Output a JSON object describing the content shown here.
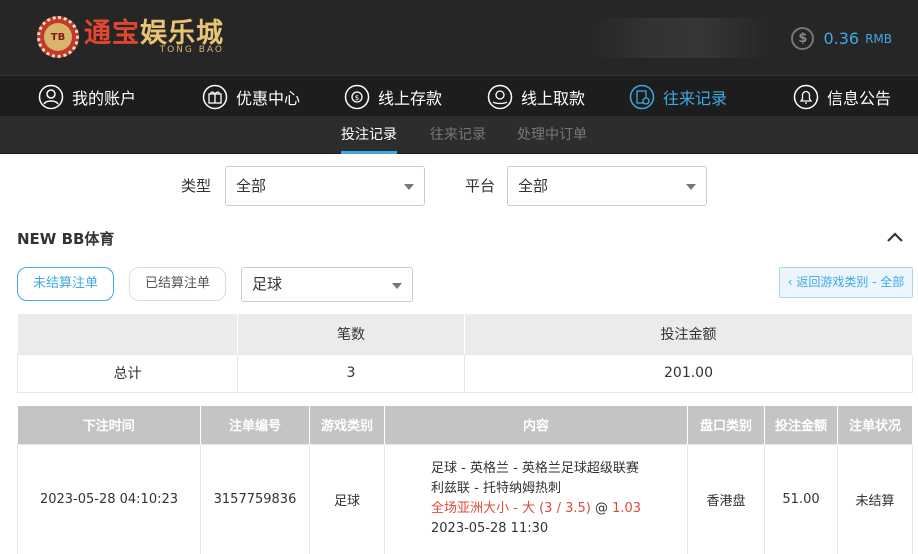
{
  "header": {
    "logo": {
      "cn_part1": "通宝",
      "cn_part2": "娱乐城",
      "en": "TONG BAO",
      "badge": "TB"
    },
    "balance": {
      "amount": "0.36",
      "currency": "RMB",
      "icon": "dollar-icon"
    }
  },
  "nav": {
    "items": [
      {
        "label": "我的账户",
        "icon": "user-icon"
      },
      {
        "label": "优惠中心",
        "icon": "gift-icon"
      },
      {
        "label": "线上存款",
        "icon": "deposit-icon"
      },
      {
        "label": "线上取款",
        "icon": "withdraw-icon"
      },
      {
        "label": "往来记录",
        "icon": "records-icon"
      },
      {
        "label": "信息公告",
        "icon": "bell-icon"
      }
    ],
    "active_index": 4
  },
  "subnav": {
    "items": [
      "投注记录",
      "往来记录",
      "处理中订单"
    ],
    "active_index": 0
  },
  "filters": {
    "type_label": "类型",
    "type_value": "全部",
    "platform_label": "平台",
    "platform_value": "全部"
  },
  "section": {
    "title": "NEW BB体育",
    "tab_unsettled": "未结算注单",
    "tab_settled": "已结算注单",
    "sport_value": "足球",
    "back_label": "‹ 返回游戏类别 - 全部"
  },
  "summary": {
    "headers": [
      "",
      "笔数",
      "投注金额"
    ],
    "row": {
      "label": "总计",
      "count": "3",
      "amount": "201.00"
    }
  },
  "bets": {
    "headers": [
      "下注时间",
      "注单编号",
      "游戏类别",
      "内容",
      "盘口类别",
      "投注金额",
      "注单状况"
    ],
    "rows": [
      {
        "time": "2023-05-28 04:10:23",
        "id": "3157759836",
        "game": "足球",
        "content_line1": "足球 - 英格兰 - 英格兰足球超级联赛",
        "content_line2": "利兹联 - 托特纳姆热刺",
        "content_bet": "全场亚洲大小 - 大 (3 / 3.5)",
        "content_at": " @ ",
        "content_odds": "1.03",
        "content_time": "2023-05-28 11:30",
        "market": "香港盘",
        "amount": "51.00",
        "status": "未结算"
      }
    ]
  },
  "colors": {
    "accent": "#3fa9e6",
    "header_bg": "#262626",
    "odds_red": "#e04a3a"
  }
}
